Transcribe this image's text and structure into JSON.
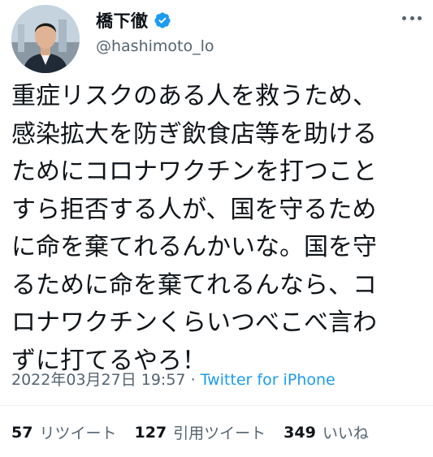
{
  "user": {
    "display_name": "橋下徹",
    "handle": "@hashimoto_lo",
    "verified": true
  },
  "tweet": {
    "text": "重症リスクのある人を救うため、\n感染拡大を防ぎ飲食店等を助ける\nためにコロナワクチンを打つこと\nすら拒否する人が、国を守るため\nに命を棄てれるんかいな。国を守\nるために命を棄てれるんなら、コ\nロナワクチンくらいつべこべ言わ\nずに打てるやろ！",
    "timestamp": "2022年03月27日 19:57",
    "separator": "·",
    "source": "Twitter for iPhone"
  },
  "stats": {
    "retweets_count": "57",
    "retweets_label": "リツイート",
    "quotes_count": "127",
    "quotes_label": "引用ツイート",
    "likes_count": "349",
    "likes_label": "いいね"
  },
  "colors": {
    "accent": "#1d9bf0",
    "secondary_text": "#536471",
    "primary_text": "#0f1419"
  },
  "icons": {
    "verified": "verified-badge-icon",
    "more": "more-options-icon"
  }
}
